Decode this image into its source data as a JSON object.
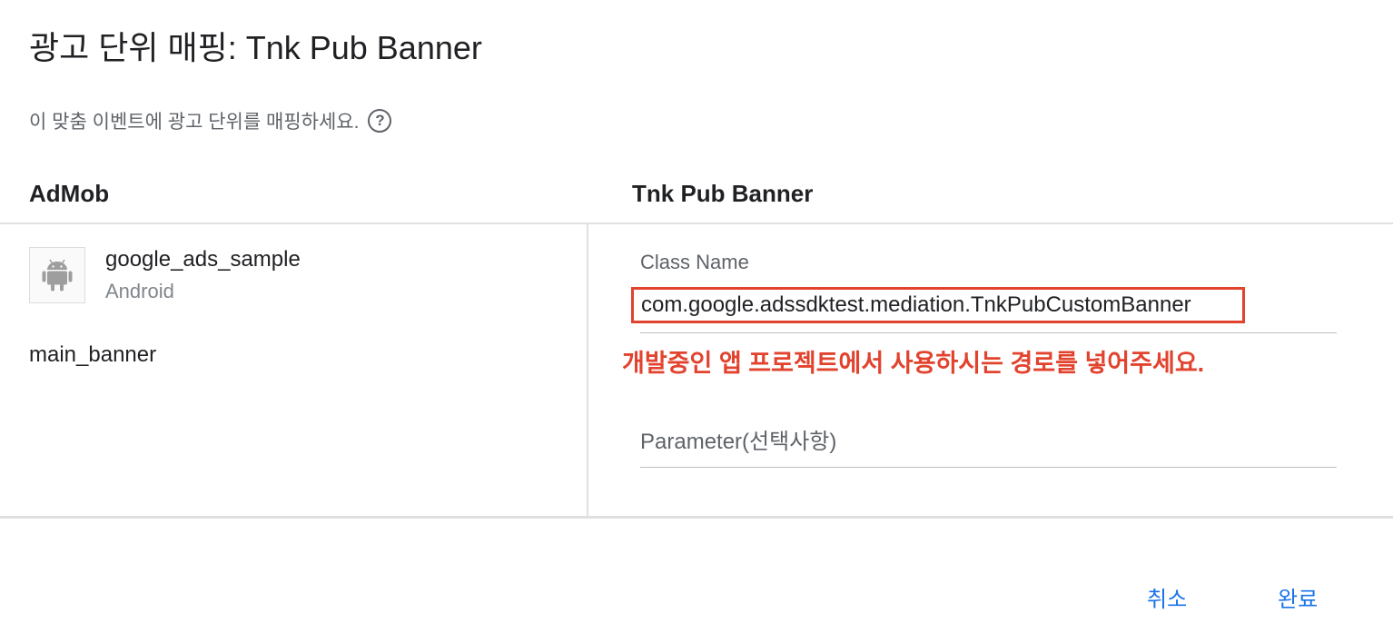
{
  "dialog": {
    "title": "광고 단위 매핑: Tnk Pub Banner",
    "subtitle": "이 맞춤 이벤트에 광고 단위를 매핑하세요.",
    "help_icon": "?"
  },
  "columns": {
    "left_header": "AdMob",
    "right_header": "Tnk Pub Banner"
  },
  "app": {
    "name": "google_ads_sample",
    "platform": "Android",
    "icon": "android-icon",
    "ad_unit": "main_banner"
  },
  "fields": {
    "class_name_label": "Class Name",
    "class_name_value": "com.google.adssdktest.mediation.TnkPubCustomBanner",
    "annotation": "개발중인 앱 프로젝트에서 사용하시는 경로를 넣어주세요.",
    "parameter_placeholder": "Parameter(선택사항)"
  },
  "actions": {
    "cancel_label": "취소",
    "done_label": "완료"
  },
  "colors": {
    "accent": "#1a73e8",
    "highlight": "#e1432e"
  }
}
